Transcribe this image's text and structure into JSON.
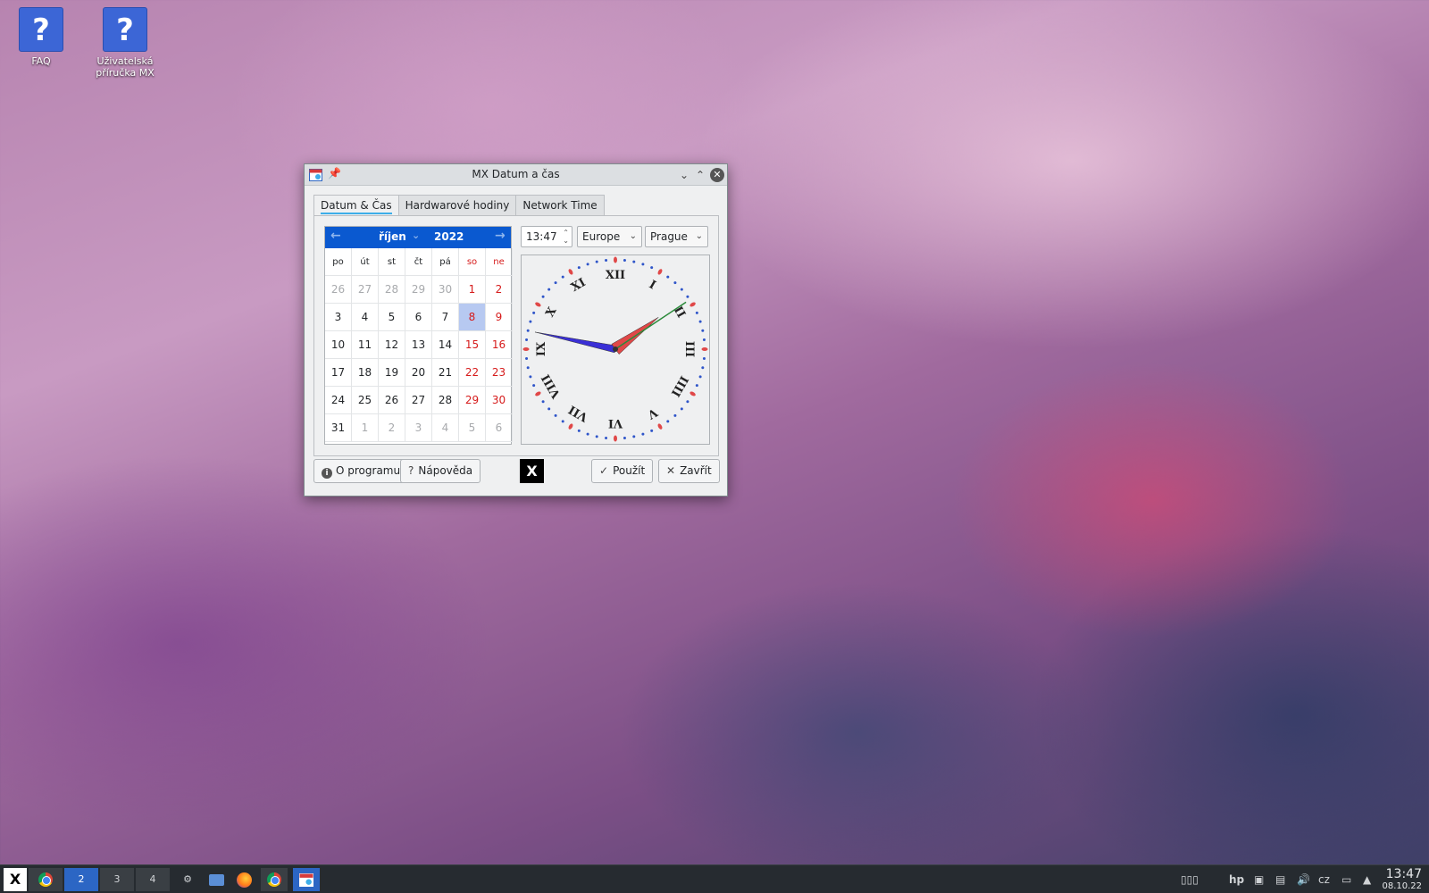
{
  "desktop": {
    "icons": [
      {
        "label": "FAQ",
        "glyph": "?"
      },
      {
        "label": "Uživatelská příručka MX",
        "glyph": "?"
      }
    ]
  },
  "window": {
    "title": "MX Datum a čas",
    "tabs": [
      {
        "label": "Datum & Čas",
        "active": true
      },
      {
        "label": "Hardwarové hodiny",
        "active": false
      },
      {
        "label": "Network Time",
        "active": false
      }
    ],
    "calendar": {
      "month": "říjen",
      "year": "2022",
      "weekdays": [
        "po",
        "út",
        "st",
        "čt",
        "pá",
        "so",
        "ne"
      ],
      "weeks": [
        [
          "26",
          "27",
          "28",
          "29",
          "30",
          "1",
          "2"
        ],
        [
          "3",
          "4",
          "5",
          "6",
          "7",
          "8",
          "9"
        ],
        [
          "10",
          "11",
          "12",
          "13",
          "14",
          "15",
          "16"
        ],
        [
          "17",
          "18",
          "19",
          "20",
          "21",
          "22",
          "23"
        ],
        [
          "24",
          "25",
          "26",
          "27",
          "28",
          "29",
          "30"
        ],
        [
          "31",
          "1",
          "2",
          "3",
          "4",
          "5",
          "6"
        ]
      ],
      "selected_day": "8",
      "colors": {
        "header": "#0a59d0",
        "weekend": "#d61b1b",
        "selected": "#b7c9f1"
      }
    },
    "time_value": "13:47",
    "region": "Europe",
    "city": "Prague",
    "clock": {
      "hour": 13,
      "minute": 47,
      "numerals": [
        "XII",
        "I",
        "II",
        "III",
        "IIII",
        "V",
        "VI",
        "VII",
        "VIII",
        "IX",
        "X",
        "XI"
      ]
    },
    "buttons": {
      "about": "O programu",
      "help": "Nápověda",
      "apply": "Použít",
      "close": "Zavřít"
    }
  },
  "taskbar": {
    "workspaces": [
      "",
      "2",
      "3",
      "4"
    ],
    "keyboard_layout": "cz",
    "time": "13:47",
    "date": "08.10.22"
  }
}
